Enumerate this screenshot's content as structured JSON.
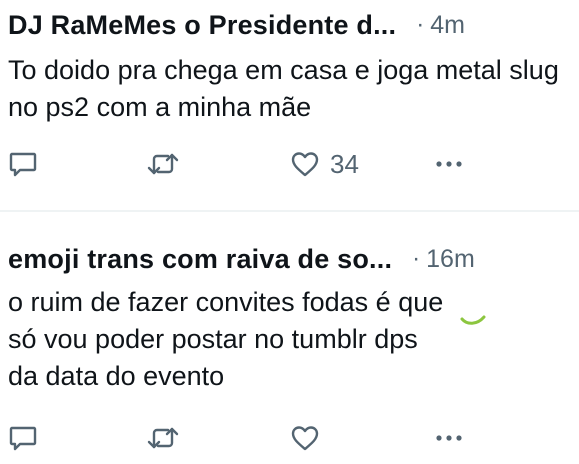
{
  "tweets": [
    {
      "author_name": "DJ RaMeMes o Presidente d...",
      "separator": "·",
      "time": "4m",
      "text": "To doido pra chega em casa e joga metal slug no ps2 com a minha mãe",
      "actions": {
        "reply_icon": "reply-icon",
        "retweet_icon": "retweet-icon",
        "like_icon": "heart-icon",
        "like_count": "34",
        "more_icon": "more-icon"
      }
    },
    {
      "author_name": "emoji trans com raiva de so...",
      "separator": "·",
      "time": "16m",
      "text_line_1": "o ruim de fazer convites fodas é que",
      "text_line_2": "só vou poder postar no tumblr dps",
      "text_line_3": "da data do evento",
      "actions": {
        "reply_icon": "reply-icon",
        "retweet_icon": "retweet-icon",
        "like_icon": "heart-icon",
        "like_count": "",
        "more_icon": "more-icon"
      }
    }
  ],
  "colors": {
    "text": "#0f1419",
    "secondary": "#536471",
    "divider": "#eff3f4",
    "annotation": "#8cc63f"
  }
}
